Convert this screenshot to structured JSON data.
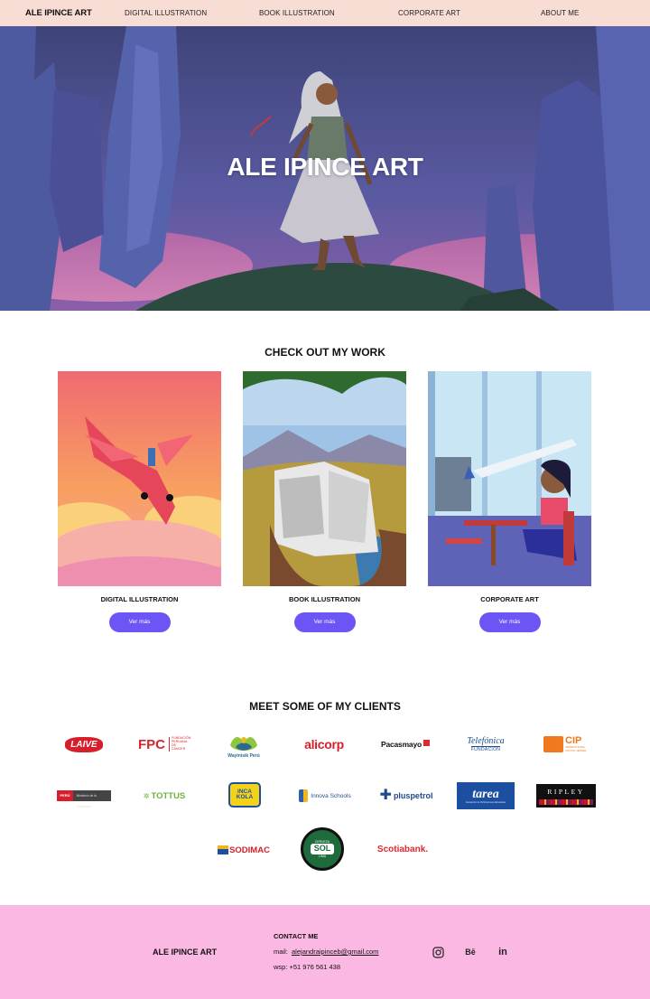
{
  "nav": {
    "brand": "ALE IPINCE ART",
    "links": [
      "DIGITAL ILLUSTRATION",
      "BOOK ILLUSTRATION",
      "CORPORATE ART",
      "ABOUT ME"
    ]
  },
  "hero": {
    "title": "ALE IPINCE ART"
  },
  "work": {
    "title": "CHECK OUT MY WORK",
    "cards": [
      {
        "title": "DIGITAL ILLUSTRATION",
        "button": "Ver más"
      },
      {
        "title": "BOOK ILLUSTRATION",
        "button": "Ver más"
      },
      {
        "title": "CORPORATE ART",
        "button": "Ver más"
      }
    ]
  },
  "clients": {
    "title": "MEET SOME OF MY CLIENTS",
    "logos": {
      "laive": "LAIVE",
      "fpc": "FPC",
      "fpc_sub": "FUNDACIÓN PERUANA DE CÁNCER",
      "wayinisik": "Wayinisik Perú",
      "alicorp": "alicorp",
      "pacasmayo": "Pacasmayo",
      "telefonica": "Telefónica",
      "telefonica_sub": "FUNDACIÓN",
      "cip": "CIP",
      "cip_sub": "INTERNATIONAL POTATO CENTER",
      "peru": "PERÚ",
      "peru_sub": "Ministerio de la Producción",
      "tottus": "TOTTUS",
      "incakola": "INCA KOLA",
      "innova": "Innova Schools",
      "pluspetrol": "pluspetrol",
      "tarea": "tarea",
      "tarea_sub": "Asociación de Publicaciones Educativas",
      "ripley": "RIPLEY",
      "sodimac": "SODIMAC",
      "sol": "SOL",
      "sol_top": "CERVEZA",
      "sol_bottom": "LIMA",
      "scotiabank": "Scotiabank."
    }
  },
  "footer": {
    "brand": "ALE IPINCE ART",
    "contact_heading": "CONTACT ME",
    "mail_label": "mail:",
    "mail": "alejandraipinceb@gmail.com",
    "wsp": "wsp: +51 976 561 438",
    "social": [
      "instagram-icon",
      "behance-icon",
      "linkedin-icon"
    ],
    "behance_text": "Bē",
    "linkedin_text": "in"
  },
  "colors": {
    "nav_bg": "#f7ddd4",
    "button": "#6c55f5",
    "footer_bg": "#fbb8e3"
  }
}
